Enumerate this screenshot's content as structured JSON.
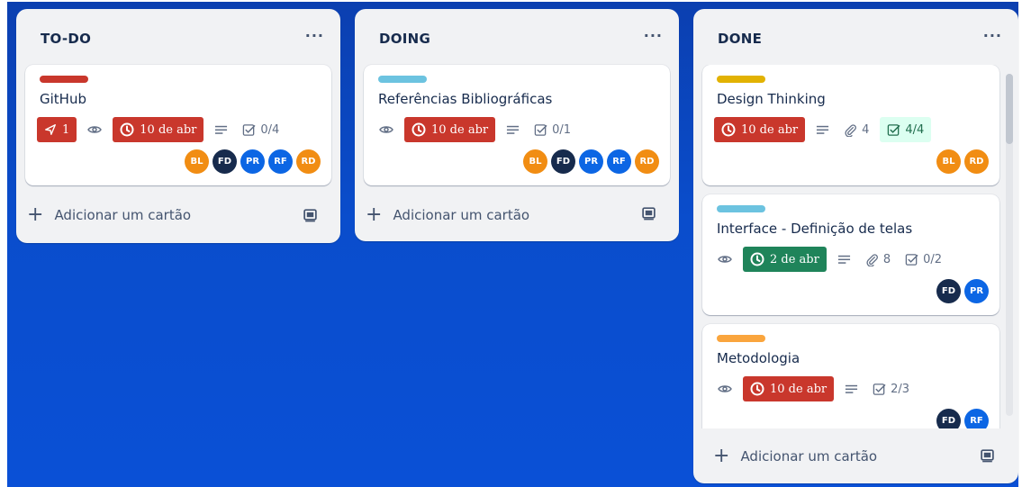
{
  "lists": [
    {
      "title": "TO-DO",
      "menu": "···",
      "add_card": "Adicionar um cartão",
      "cards": [
        {
          "label_color": "#c9372c",
          "title": "GitHub",
          "pin_count": "1",
          "due": "10 de abr",
          "checklist": "0/4",
          "members": [
            "BL",
            "FD",
            "PR",
            "RF",
            "RD"
          ]
        }
      ]
    },
    {
      "title": "DOING",
      "menu": "···",
      "add_card": "Adicionar um cartão",
      "cards": [
        {
          "label_color": "#6cc3e0",
          "title": "Referências Bibliográficas",
          "due": "10 de abr",
          "checklist": "0/1",
          "members": [
            "BL",
            "FD",
            "PR",
            "RF",
            "RD"
          ]
        }
      ]
    },
    {
      "title": "DONE",
      "menu": "···",
      "add_card": "Adicionar um cartão",
      "cards": [
        {
          "label_color": "#e2b203",
          "title": "Design Thinking",
          "due": "10 de abr",
          "attachments": "4",
          "checklist": "4/4",
          "members": [
            "BL",
            "RD"
          ]
        },
        {
          "label_color": "#6cc3e0",
          "title": "Interface - Definição de telas",
          "due": "2 de abr",
          "attachments": "8",
          "checklist": "0/2",
          "members": [
            "FD",
            "PR"
          ]
        },
        {
          "label_color": "#faa53d",
          "title": "Metodologia",
          "due": "10 de abr",
          "checklist": "2/3",
          "members": [
            "FD",
            "RF"
          ]
        }
      ]
    }
  ],
  "icons": {
    "pin": "pin-icon",
    "watch": "eye-icon",
    "clock": "clock-icon",
    "description": "description-icon",
    "checklist": "checklist-icon",
    "attachment": "paperclip-icon",
    "template": "card-template-icon",
    "add": "plus-icon"
  },
  "colors": {
    "due_overdue": "#c9372c",
    "due_complete": "#1f845a",
    "checklist_complete_bg": "#dcfff1",
    "board_background": "#0a4dcc"
  }
}
